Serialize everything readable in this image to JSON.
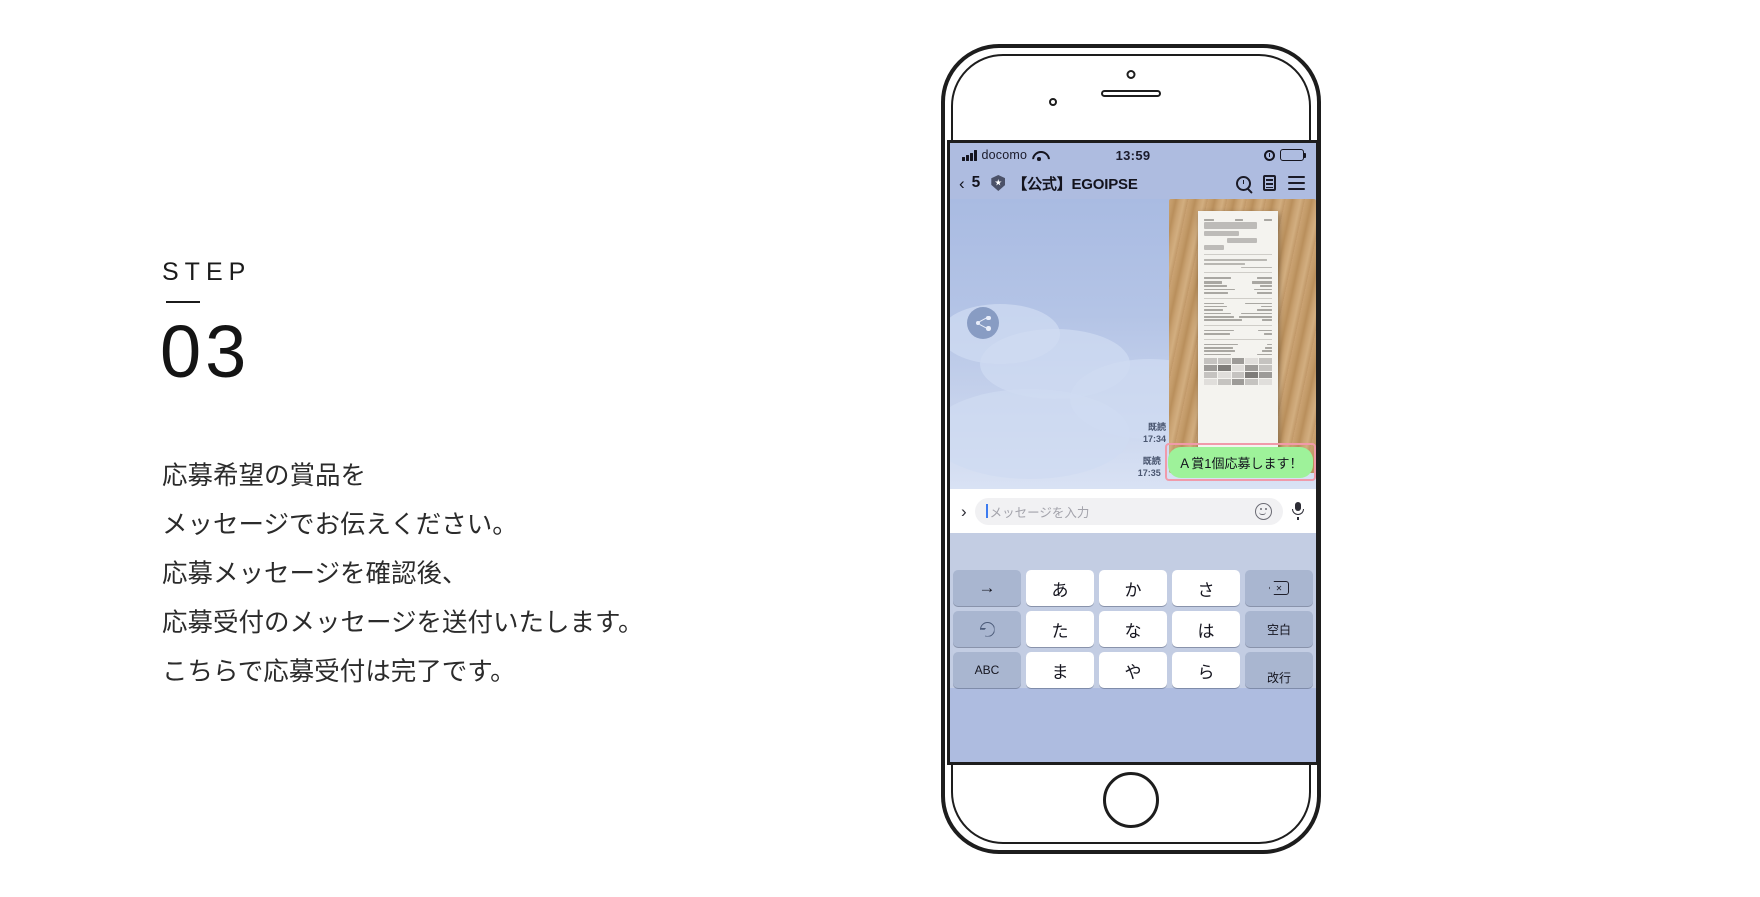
{
  "step": {
    "label": "STEP",
    "number": "03",
    "body_lines": [
      "応募希望の賞品を",
      "メッセージでお伝えください。",
      "応募メッセージを確認後、",
      "応募受付のメッセージを送付いたします。",
      "こちらで応募受付は完了です。"
    ]
  },
  "phone": {
    "statusbar": {
      "carrier": "docomo",
      "time": "13:59",
      "signal_icon": "signal-bars-icon",
      "wifi_icon": "wifi-icon",
      "alarm_icon": "alarm-clock-icon",
      "battery_icon": "battery-full-icon"
    },
    "chat_header": {
      "back_glyph": "‹",
      "unread_count": "5",
      "shield_icon": "official-badge-icon",
      "title": "【公式】EGOIPSE",
      "search_icon": "search-icon",
      "note_icon": "note-icon",
      "menu_icon": "hamburger-menu-icon"
    },
    "chat": {
      "share_icon": "share-icon",
      "photo_message": {
        "alt": "receipt-photo",
        "read_label": "既読",
        "time": "17:34"
      },
      "text_message": {
        "read_label": "既読",
        "time": "17:35",
        "text": "Ａ賞1個応募します！",
        "bubble_color": "#9ef29a",
        "highlight_color": "#f09aaa"
      }
    },
    "input_bar": {
      "expand_glyph": "›",
      "placeholder": "メッセージを入力",
      "value": "",
      "smiley_icon": "smiley-icon",
      "mic_icon": "microphone-icon"
    },
    "keyboard": {
      "rows": [
        [
          {
            "label": "→",
            "style": "dark",
            "name": "key-arrow-right"
          },
          {
            "label": "あ",
            "style": "light",
            "name": "key-a"
          },
          {
            "label": "か",
            "style": "light",
            "name": "key-ka"
          },
          {
            "label": "さ",
            "style": "light",
            "name": "key-sa"
          },
          {
            "label": "",
            "style": "dark",
            "name": "key-backspace",
            "icon": "backspace-icon"
          }
        ],
        [
          {
            "label": "",
            "style": "dark",
            "name": "key-undo",
            "icon": "undo-icon"
          },
          {
            "label": "た",
            "style": "light",
            "name": "key-ta"
          },
          {
            "label": "な",
            "style": "light",
            "name": "key-na"
          },
          {
            "label": "は",
            "style": "light",
            "name": "key-ha"
          },
          {
            "label": "空白",
            "style": "dark",
            "name": "key-space"
          }
        ],
        [
          {
            "label": "ABC",
            "style": "dark",
            "name": "key-abc"
          },
          {
            "label": "ま",
            "style": "light",
            "name": "key-ma"
          },
          {
            "label": "や",
            "style": "light",
            "name": "key-ya"
          },
          {
            "label": "ら",
            "style": "light",
            "name": "key-ra"
          },
          {
            "label": "改行",
            "style": "dark",
            "name": "key-return"
          }
        ]
      ]
    }
  }
}
